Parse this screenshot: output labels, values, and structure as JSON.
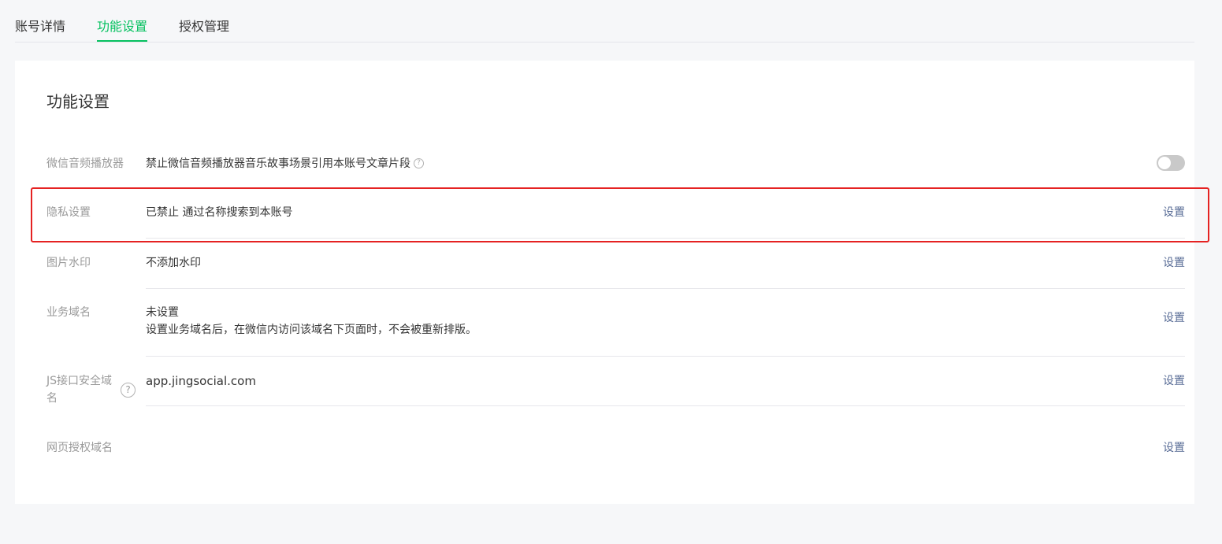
{
  "tabs": [
    {
      "label": "账号详情"
    },
    {
      "label": "功能设置",
      "active": true
    },
    {
      "label": "授权管理"
    }
  ],
  "card": {
    "title": "功能设置"
  },
  "rows": {
    "audio": {
      "label": "微信音频播放器",
      "value": "禁止微信音频播放器音乐故事场景引用本账号文章片段",
      "help_icon": "question-circle-icon",
      "toggle_on": false
    },
    "privacy": {
      "label": "隐私设置",
      "value": "已禁止 通过名称搜索到本账号",
      "action": "设置"
    },
    "watermark": {
      "label": "图片水印",
      "value": "不添加水印",
      "action": "设置"
    },
    "business_domain": {
      "label": "业务域名",
      "value": "未设置",
      "description": "设置业务域名后，在微信内访问该域名下页面时，不会被重新排版。",
      "action": "设置"
    },
    "js_domain": {
      "label_line1": "JS接口安全域",
      "label_line2": "名",
      "value": "app.jingsocial.com",
      "help_icon": "question-circle-icon",
      "action": "设置"
    },
    "oauth_domain": {
      "label": "网页授权域名",
      "action": "设置"
    }
  },
  "colors": {
    "accent": "#07c160",
    "link": "#576b95",
    "highlight": "#e52222"
  }
}
